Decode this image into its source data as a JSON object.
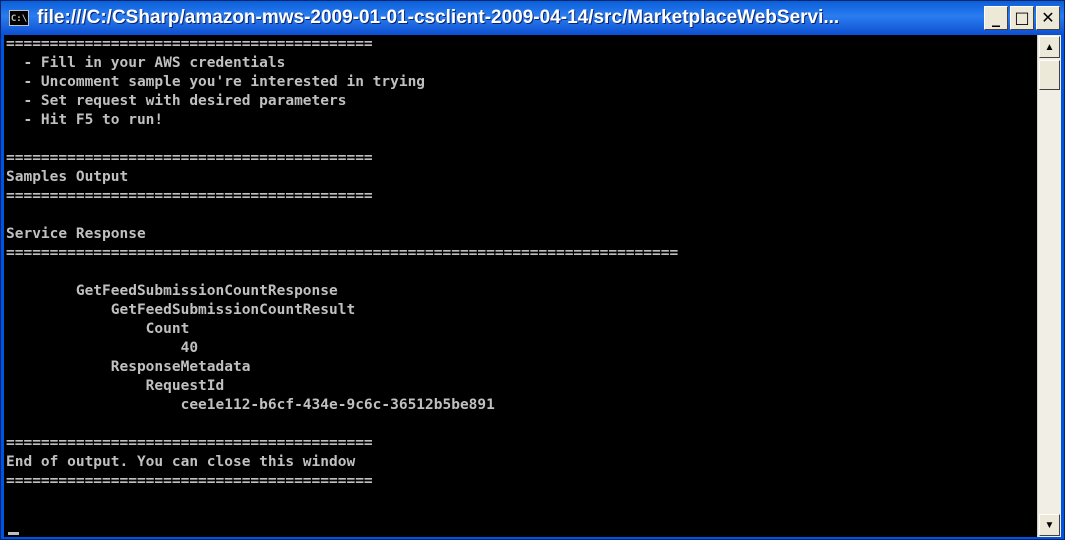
{
  "window": {
    "icon_text": "C:\\",
    "title": "file:///C:/CSharp/amazon-mws-2009-01-01-csclient-2009-04-14/src/MarketplaceWebServi...",
    "minimize_glyph": "_",
    "maximize_glyph": "□",
    "close_glyph": "✕"
  },
  "console": {
    "lines": [
      "==========================================",
      "  - Fill in your AWS credentials",
      "  - Uncomment sample you're interested in trying",
      "  - Set request with desired parameters",
      "  - Hit F5 to run!",
      "",
      "==========================================",
      "Samples Output",
      "==========================================",
      "",
      "Service Response",
      "=============================================================================",
      "",
      "        GetFeedSubmissionCountResponse",
      "            GetFeedSubmissionCountResult",
      "                Count",
      "                    40",
      "            ResponseMetadata",
      "                RequestId",
      "                    cee1e112-b6cf-434e-9c6c-36512b5be891",
      "",
      "==========================================",
      "End of output. You can close this window",
      "=========================================="
    ]
  },
  "scrollbar": {
    "up_glyph": "▲",
    "down_glyph": "▼"
  },
  "colors": {
    "console_bg": "#000000",
    "console_text": "#c0c0c0",
    "titlebar": "#0a5fd8"
  }
}
